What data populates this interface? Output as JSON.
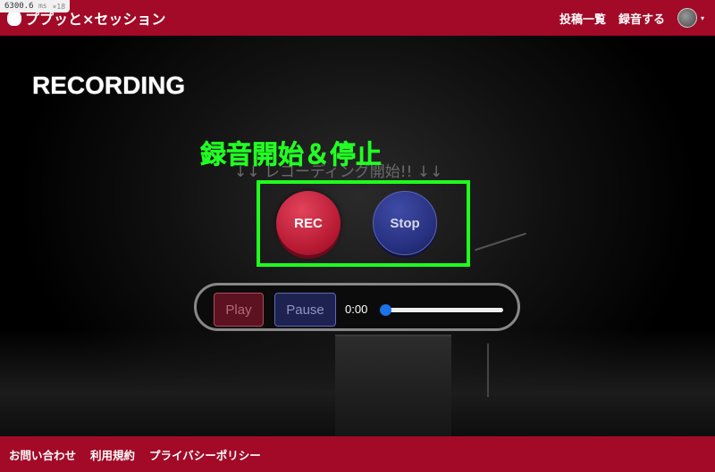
{
  "perf": {
    "value": "6300.6",
    "unit": "ms",
    "multiplier": "×18"
  },
  "brand": {
    "name": "ププッと×セッション"
  },
  "nav": {
    "posts_label": "投稿一覧",
    "record_label": "録音する",
    "avatar_icon": "user-avatar",
    "caret_icon": "▾"
  },
  "page": {
    "title": "RECORDING",
    "annotation": "録音開始＆停止",
    "hint": "↓↓ レコーディング開始!! ↓↓"
  },
  "controls": {
    "rec_label": "REC",
    "stop_label": "Stop"
  },
  "player": {
    "play_label": "Play",
    "pause_label": "Pause",
    "time": "0:00",
    "progress": 0
  },
  "footer": {
    "links": [
      "お問い合わせ",
      "利用規約",
      "プライバシーポリシー"
    ]
  },
  "colors": {
    "brand": "#a20a27",
    "rec": "#b81a34",
    "stop": "#27307f",
    "annotation": "#22ff22"
  }
}
